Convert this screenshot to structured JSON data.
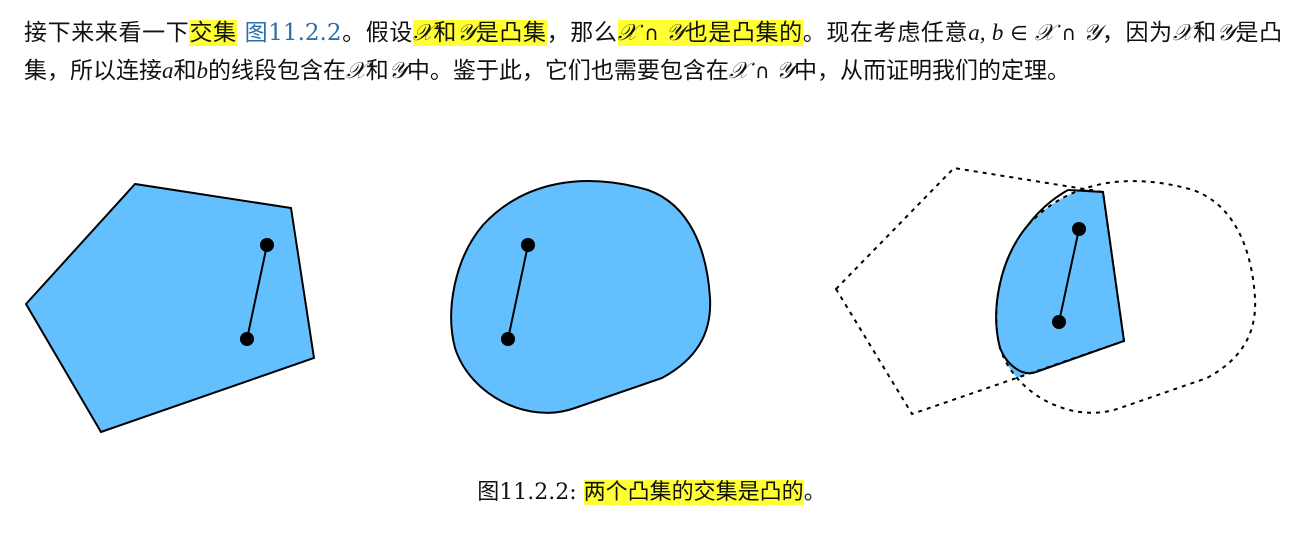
{
  "paragraph": {
    "p1": "接下来来看一下",
    "hl1": "交集",
    "space1": " ",
    "ref_prefix": "图",
    "ref_num": "11.2.2",
    "p2": "。假设",
    "hl2_X": "𝒳",
    "hl2_and": "和",
    "hl2_Y": "𝒴",
    "hl2_tail": "是凸集",
    "p3": "，那么",
    "hl3_X": "𝒳",
    "hl3_cap": " ∩ ",
    "hl3_Y": "𝒴",
    "hl3_tail": "也是凸集的",
    "p4": "。现在考虑任意",
    "m_a": "a",
    "m_comma": ", ",
    "m_b": "b",
    "m_in": " ∈ ",
    "m_X": "𝒳",
    "m_cap": " ∩ ",
    "m_Y": "𝒴",
    "p5": "，因为",
    "p5_X": "𝒳",
    "p5_and": "和",
    "p5_Y": "𝒴",
    "p6": "是凸集，所以连接",
    "p6_a": "a",
    "p6_and": "和",
    "p6_b": "b",
    "p7": "的线段包含在",
    "p7_X": "𝒳",
    "p7_and": "和",
    "p7_Y": "𝒴",
    "p8": "中。鉴于此，它们也需要包含在",
    "p8_X": "𝒳",
    "p8_cap": " ∩ ",
    "p8_Y": "𝒴",
    "p9": "中，从而证明我们的定理。"
  },
  "figure": {
    "fill_color": "#64bfff",
    "stroke_color": "#000000",
    "panels": [
      "convex polygon (pentagon) containing segment",
      "convex rounded blob containing segment",
      "intersection of pentagon and blob containing segment"
    ]
  },
  "caption": {
    "label": "图11.2.2: ",
    "text": "两个凸集的交集是凸的",
    "end": "。"
  }
}
